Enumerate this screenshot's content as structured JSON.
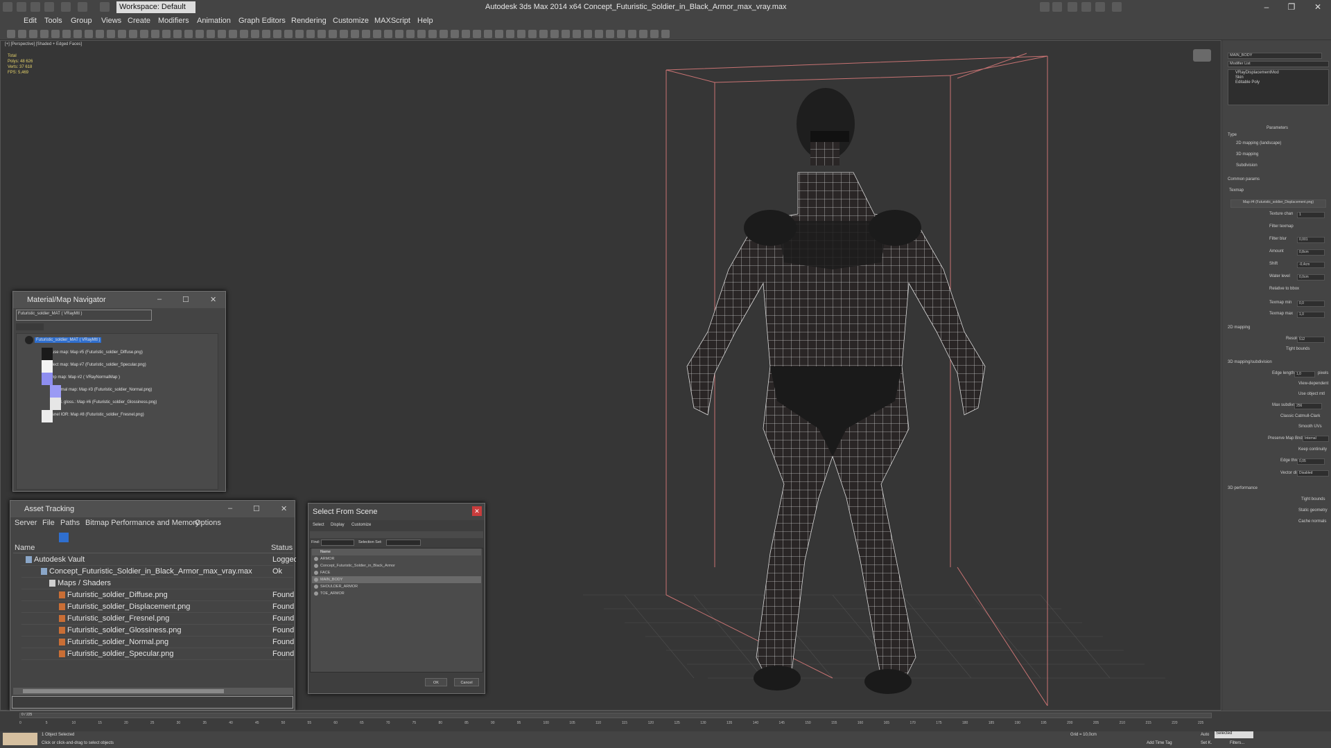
{
  "app": {
    "title": "Autodesk 3ds Max  2014 x64     Concept_Futuristic_Soldier_in_Black_Armor_max_vray.max",
    "workspace": "Workspace: Default"
  },
  "menu": [
    "Edit",
    "Tools",
    "Group",
    "Views",
    "Create",
    "Modifiers",
    "Animation",
    "Graph Editors",
    "Rendering",
    "Customize",
    "MAXScript",
    "Help"
  ],
  "viewport": {
    "label": "[+] [Perspective] [Shaded + Edged Faces]",
    "stats": [
      "Total",
      "Polys:  48 626",
      "Verts:  37 618",
      "",
      "FPS:    5,469"
    ]
  },
  "command_panel": {
    "object_name": "MAIN_BODY",
    "modifier_list": "Modifier List",
    "modifiers": [
      "VRayDisplacementMod",
      "Skin",
      "Editable Poly"
    ],
    "parameters": "Parameters",
    "type_label": "Type",
    "type_options": [
      "2D mapping (landscape)",
      "3D mapping",
      "Subdivision"
    ],
    "common_params": "Common params",
    "texmap": "Texmap",
    "map_button": "Map #4 (Futuristic_soldier_Displacement.png)",
    "fields": [
      {
        "label": "Texture chan",
        "value": "1"
      },
      {
        "label": "Filter texmap",
        "value": ""
      },
      {
        "label": "Filter blur",
        "value": "0,001"
      },
      {
        "label": "Amount",
        "value": "0,8cm"
      },
      {
        "label": "Shift",
        "value": "-0,4cm"
      },
      {
        "label": "Water level",
        "value": "0,0cm"
      },
      {
        "label": "Relative to bbox",
        "value": ""
      },
      {
        "label": "Texmap min",
        "value": "0,0"
      },
      {
        "label": "Texmap max",
        "value": "1,0"
      }
    ],
    "section_2d": "2D mapping",
    "resolution_label": "Resolution",
    "resolution_value": "512",
    "tight_bounds": "Tight bounds",
    "section_3d": "3D mapping/subdivision",
    "edge_length_label": "Edge length",
    "edge_length_value": "1,0",
    "pixels": "pixels",
    "sub_rows": [
      "View-dependent",
      "Use object mtl"
    ],
    "max_subdivs_label": "Max subdivs",
    "max_subdivs_value": "256",
    "sub_rows2": [
      "Classic Catmull-Clark",
      "Smooth UVs"
    ],
    "preserve_label": "Preserve Map Bnd",
    "preserve_value": "Internal",
    "keep_continuity": "Keep continuity",
    "edge_thresh_label": "Edge thresh",
    "edge_thresh_value": "0,05",
    "vector_disp_label": "Vector displ",
    "vector_disp_value": "Disabled",
    "section_perf": "3D performance",
    "perf_rows": [
      "Tight bounds",
      "Static geometry",
      "Cache normals"
    ]
  },
  "material_navigator": {
    "title": "Material/Map Navigator",
    "current": "Futuristic_soldier_MAT  ( VRayMtl )",
    "root": "Futuristic_soldier_MAT  ( VRayMtl )",
    "items": [
      "Diffuse map: Map #5 (Futuristic_soldier_Diffuse.png)",
      "Reflect map: Map #7 (Futuristic_soldier_Specular.png)",
      "Bump map: Map #2  ( VRayNormalMap )",
      "Normal map: Map #3 (Futuristic_soldier_Normal.png)",
      "Refl. gloss.: Map #6 (Futuristic_soldier_Glossiness.png)",
      "Fresnel IOR: Map #8 (Futuristic_soldier_Fresnel.png)"
    ],
    "swatch_colors": [
      "#1a1a1a",
      "#f2f2f2",
      "#8e8ef0",
      "#9a9af4",
      "#e6e6e6",
      "#ededed"
    ]
  },
  "asset_tracking": {
    "title": "Asset Tracking",
    "menu": [
      "Server",
      "File",
      "Paths",
      "Bitmap Performance and Memory",
      "Options"
    ],
    "col_name": "Name",
    "col_status": "Status",
    "rows": [
      {
        "name": "Autodesk Vault",
        "status": "Logged Ou",
        "indent": 0
      },
      {
        "name": "Concept_Futuristic_Soldier_in_Black_Armor_max_vray.max",
        "status": "Ok",
        "indent": 1
      },
      {
        "name": "Maps / Shaders",
        "status": "",
        "indent": 2
      },
      {
        "name": "Futuristic_soldier_Diffuse.png",
        "status": "Found",
        "indent": 3
      },
      {
        "name": "Futuristic_soldier_Displacement.png",
        "status": "Found",
        "indent": 3
      },
      {
        "name": "Futuristic_soldier_Fresnel.png",
        "status": "Found",
        "indent": 3
      },
      {
        "name": "Futuristic_soldier_Glossiness.png",
        "status": "Found",
        "indent": 3
      },
      {
        "name": "Futuristic_soldier_Normal.png",
        "status": "Found",
        "indent": 3
      },
      {
        "name": "Futuristic_soldier_Specular.png",
        "status": "Found",
        "indent": 3
      }
    ]
  },
  "select_from_scene": {
    "title": "Select From Scene",
    "menu": [
      "Select",
      "Display",
      "Customize"
    ],
    "find_label": "Find:",
    "selection_set": "Selection Set:",
    "col_name": "Name",
    "rows": [
      "ARMOR",
      "Concept_Futuristic_Soldier_in_Black_Armor",
      "FACE",
      "MAIN_BODY",
      "SHOULDER_ARMOR",
      "TOE_ARMOR"
    ],
    "selected_index": 3,
    "ok": "OK",
    "cancel": "Cancel"
  },
  "timeline": {
    "frame": "0 / 225",
    "ticks": [
      "0",
      "5",
      "10",
      "15",
      "20",
      "25",
      "30",
      "35",
      "40",
      "45",
      "50",
      "55",
      "60",
      "65",
      "70",
      "75",
      "80",
      "85",
      "90",
      "95",
      "100",
      "105",
      "110",
      "115",
      "120",
      "125",
      "130",
      "135",
      "140",
      "145",
      "150",
      "155",
      "160",
      "165",
      "170",
      "175",
      "180",
      "185",
      "190",
      "195",
      "200",
      "205",
      "210",
      "215",
      "220",
      "225"
    ]
  },
  "status": {
    "selected": "1 Object Selected",
    "hint": "Click or click-and-drag to select objects",
    "grid": "Grid = 10,0cm",
    "auto": "Auto",
    "selected_dd": "Selected",
    "set_k": "Set K.",
    "filters": "Filters...",
    "add_time_tag": "Add Time Tag"
  }
}
